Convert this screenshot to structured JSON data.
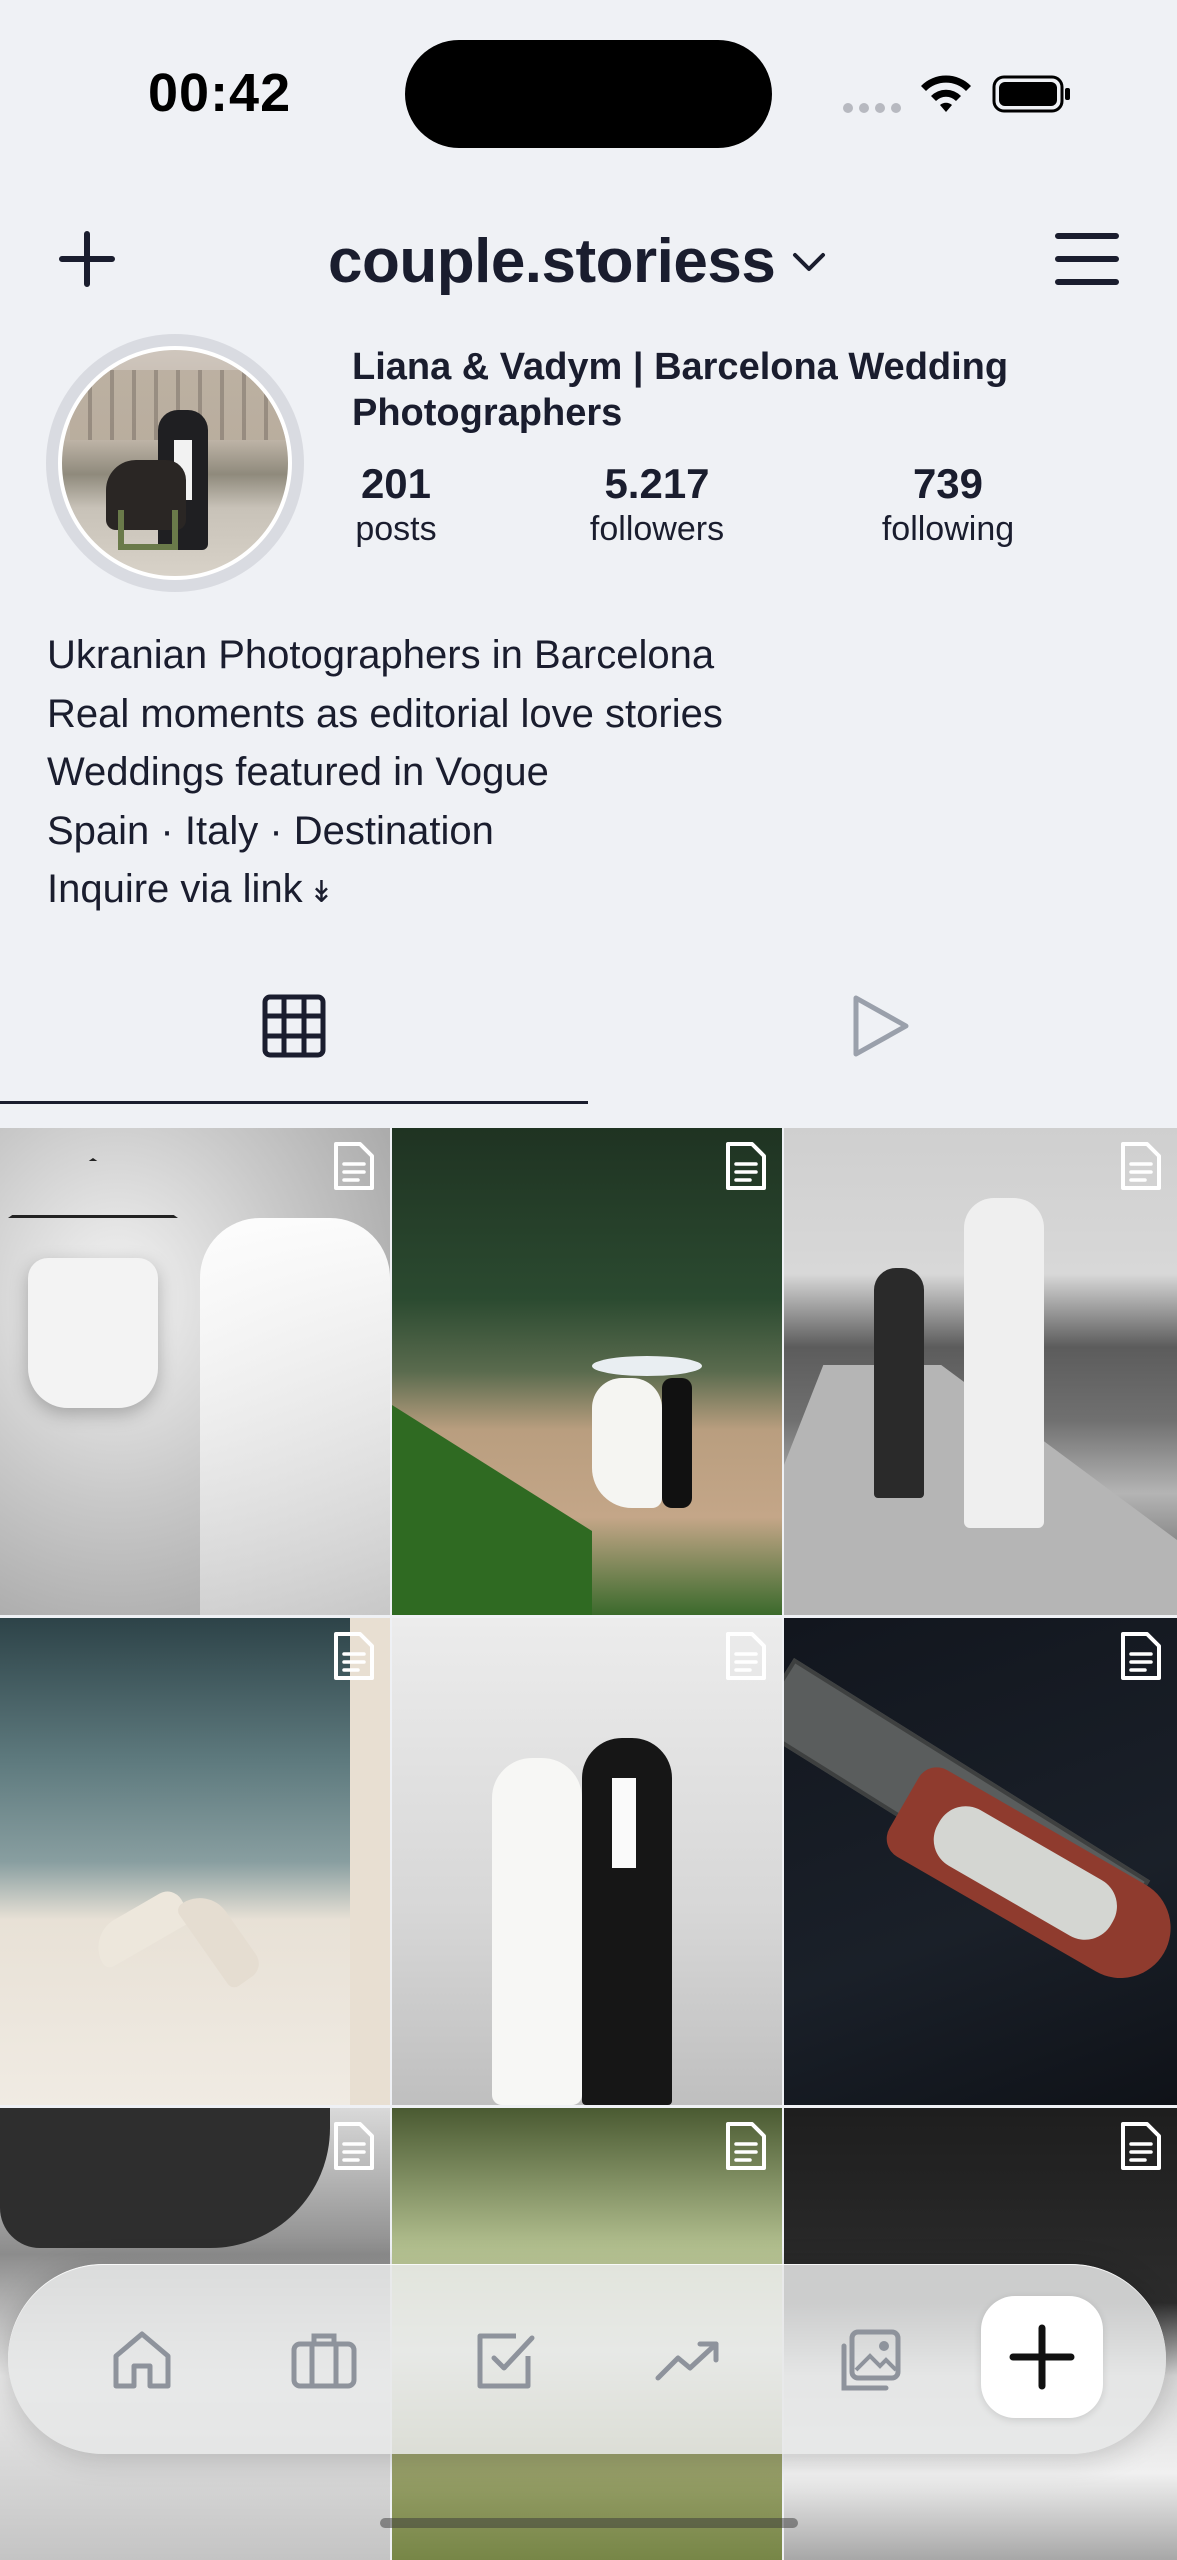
{
  "status_bar": {
    "time": "00:42"
  },
  "header": {
    "username": "couple.storiess"
  },
  "profile": {
    "display_name": "Liana & Vadym | Barcelona Wedding Photographers",
    "stats": [
      {
        "value": "201",
        "label": "posts"
      },
      {
        "value": "5.217",
        "label": "followers"
      },
      {
        "value": "739",
        "label": "following"
      }
    ],
    "bio": [
      "Ukranian Photographers in Barcelona",
      "Real moments as editorial love stories",
      "Weddings featured in Vogue",
      "Spain · Italy · Destination",
      "Inquire via link"
    ],
    "bio_link_arrow": "↡"
  },
  "tabs": [
    {
      "icon": "grid-icon",
      "active": true
    },
    {
      "icon": "play-icon",
      "active": false
    }
  ],
  "grid_posts": [
    {
      "icon": "document-icon"
    },
    {
      "icon": "document-icon"
    },
    {
      "icon": "document-icon"
    },
    {
      "icon": "document-icon"
    },
    {
      "icon": "document-icon"
    },
    {
      "icon": "document-icon"
    },
    {
      "icon": "document-icon"
    },
    {
      "icon": "document-icon"
    },
    {
      "icon": "document-icon"
    }
  ],
  "bottom_nav": [
    {
      "icon": "home-icon"
    },
    {
      "icon": "briefcase-icon"
    },
    {
      "icon": "checkbox-icon"
    },
    {
      "icon": "trending-icon"
    },
    {
      "icon": "images-icon"
    },
    {
      "icon": "plus-icon"
    }
  ],
  "colors": {
    "text": "#1a1d2e",
    "background": "#eff1f5",
    "inactive_icon": "#9aa0ab"
  }
}
